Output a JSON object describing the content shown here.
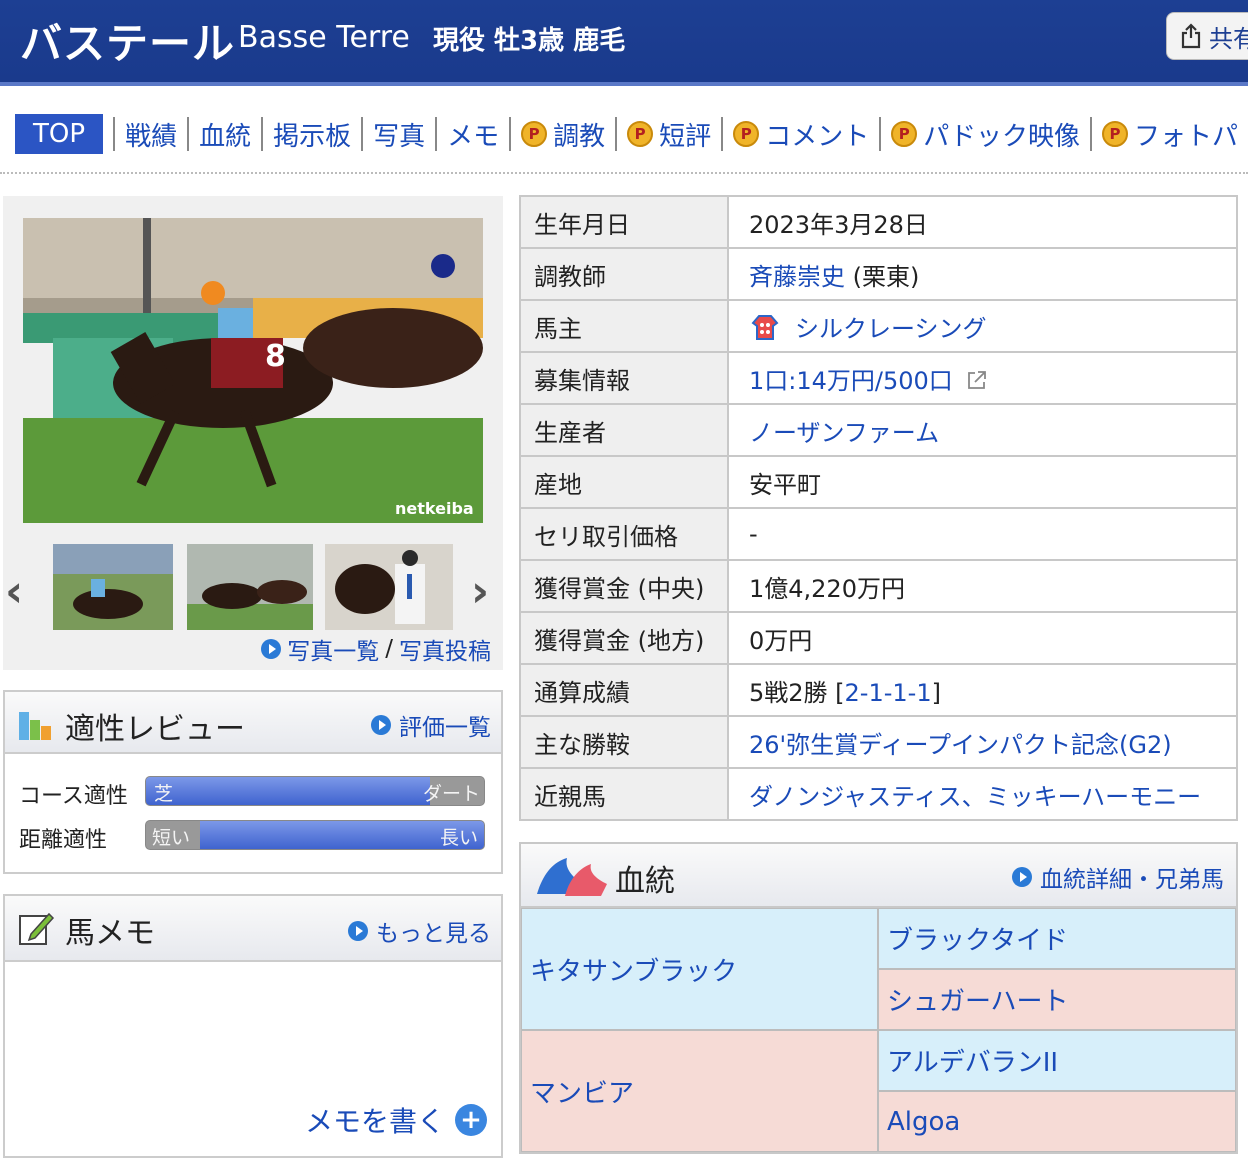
{
  "header": {
    "name_ja": "バステール",
    "name_en": "Basse Terre",
    "status": "現役 牡3歳 鹿毛",
    "share_label": "共有"
  },
  "nav": {
    "top": "TOP",
    "items": [
      "戦績",
      "血統",
      "掲示板",
      "写真",
      "メモ"
    ],
    "premium_badge": "P",
    "premium_items": [
      "調教",
      "短評",
      "コメント",
      "パドック映像",
      "フォトパ"
    ]
  },
  "photo": {
    "watermark": "netkeiba",
    "list_link": "写真一覧",
    "separator": "/",
    "post_link": "写真投稿"
  },
  "aptitude": {
    "title": "適性レビュー",
    "link": "評価一覧",
    "course_label": "コース適性",
    "course_left": "芝",
    "course_right": "ダート",
    "course_level": 0.84,
    "distance_label": "距離適性",
    "distance_left": "短い",
    "distance_right": "長い",
    "distance_level": 0.84
  },
  "memo": {
    "title": "馬メモ",
    "link": "もっと見る",
    "write": "メモを書く",
    "plus": "+"
  },
  "profile": {
    "rows": [
      {
        "key": "生年月日",
        "value": "2023年3月28日"
      },
      {
        "key": "調教師",
        "link": "斉藤崇史",
        "suffix": " (栗東)"
      },
      {
        "key": "馬主",
        "link": "シルクレーシング"
      },
      {
        "key": "募集情報",
        "link": "1口:14万円/500口"
      },
      {
        "key": "生産者",
        "link": "ノーザンファーム"
      },
      {
        "key": "産地",
        "value": "安平町"
      },
      {
        "key": "セリ取引価格",
        "value": "-"
      },
      {
        "key": "獲得賞金 (中央)",
        "value": "1億4,220万円"
      },
      {
        "key": "獲得賞金 (地方)",
        "value": "0万円"
      },
      {
        "key": "通算成績",
        "prefix": "5戦2勝 [",
        "link": "2-1-1-1",
        "suffix": "]"
      },
      {
        "key": "主な勝鞍",
        "link": "26'弥生賞ディープインパクト記念(G2)"
      },
      {
        "key": "近親馬",
        "link": "ダノンジャスティス、ミッキーハーモニー"
      }
    ]
  },
  "pedigree": {
    "title": "血統",
    "link": "血統詳細・兄弟馬",
    "sire": "キタサンブラック",
    "sire_sire": "ブラックタイド",
    "sire_dam": "シュガーハート",
    "dam": "マンビア",
    "dam_sire": "アルデバランII",
    "dam_dam": "Algoa"
  }
}
